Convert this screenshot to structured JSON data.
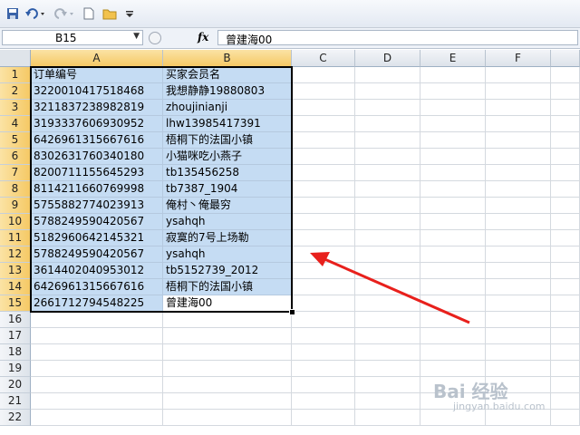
{
  "name_box": "B15",
  "formula": "曾建海00",
  "fx": "fx",
  "columns": [
    "A",
    "B",
    "C",
    "D",
    "E",
    "F"
  ],
  "rows": [
    {
      "n": "1",
      "a": "订单编号",
      "b": "买家会员名"
    },
    {
      "n": "2",
      "a": "3220010417518468",
      "b": "我想静静19880803"
    },
    {
      "n": "3",
      "a": "3211837238982819",
      "b": "zhoujinianji"
    },
    {
      "n": "4",
      "a": "3193337606930952",
      "b": "lhw13985417391"
    },
    {
      "n": "5",
      "a": "6426961315667616",
      "b": "梧桐下的法国小镇"
    },
    {
      "n": "6",
      "a": "8302631760340180",
      "b": "小猫咪吃小燕子"
    },
    {
      "n": "7",
      "a": "8200711155645293",
      "b": "tb135456258"
    },
    {
      "n": "8",
      "a": "8114211660769998",
      "b": "tb7387_1904"
    },
    {
      "n": "9",
      "a": "5755882774023913",
      "b": "俺村丶俺最穷"
    },
    {
      "n": "10",
      "a": "5788249590420567",
      "b": "ysahqh"
    },
    {
      "n": "11",
      "a": "5182960642145321",
      "b": "寂寞的7号上场勒"
    },
    {
      "n": "12",
      "a": "5788249590420567",
      "b": "ysahqh"
    },
    {
      "n": "13",
      "a": "3614402040953012",
      "b": "tb5152739_2012"
    },
    {
      "n": "14",
      "a": "6426961315667616",
      "b": "梧桐下的法国小镇"
    },
    {
      "n": "15",
      "a": "2661712794548225",
      "b": "曾建海00"
    },
    {
      "n": "16",
      "a": "",
      "b": ""
    },
    {
      "n": "17",
      "a": "",
      "b": ""
    },
    {
      "n": "18",
      "a": "",
      "b": ""
    },
    {
      "n": "19",
      "a": "",
      "b": ""
    },
    {
      "n": "20",
      "a": "",
      "b": ""
    },
    {
      "n": "21",
      "a": "",
      "b": ""
    },
    {
      "n": "22",
      "a": "",
      "b": ""
    }
  ],
  "watermark": "Bai 经验",
  "watermark_sub": "jingyan.baidu.com",
  "colors": {
    "selection": "#c5dcf3",
    "arrow": "#e8201c"
  }
}
